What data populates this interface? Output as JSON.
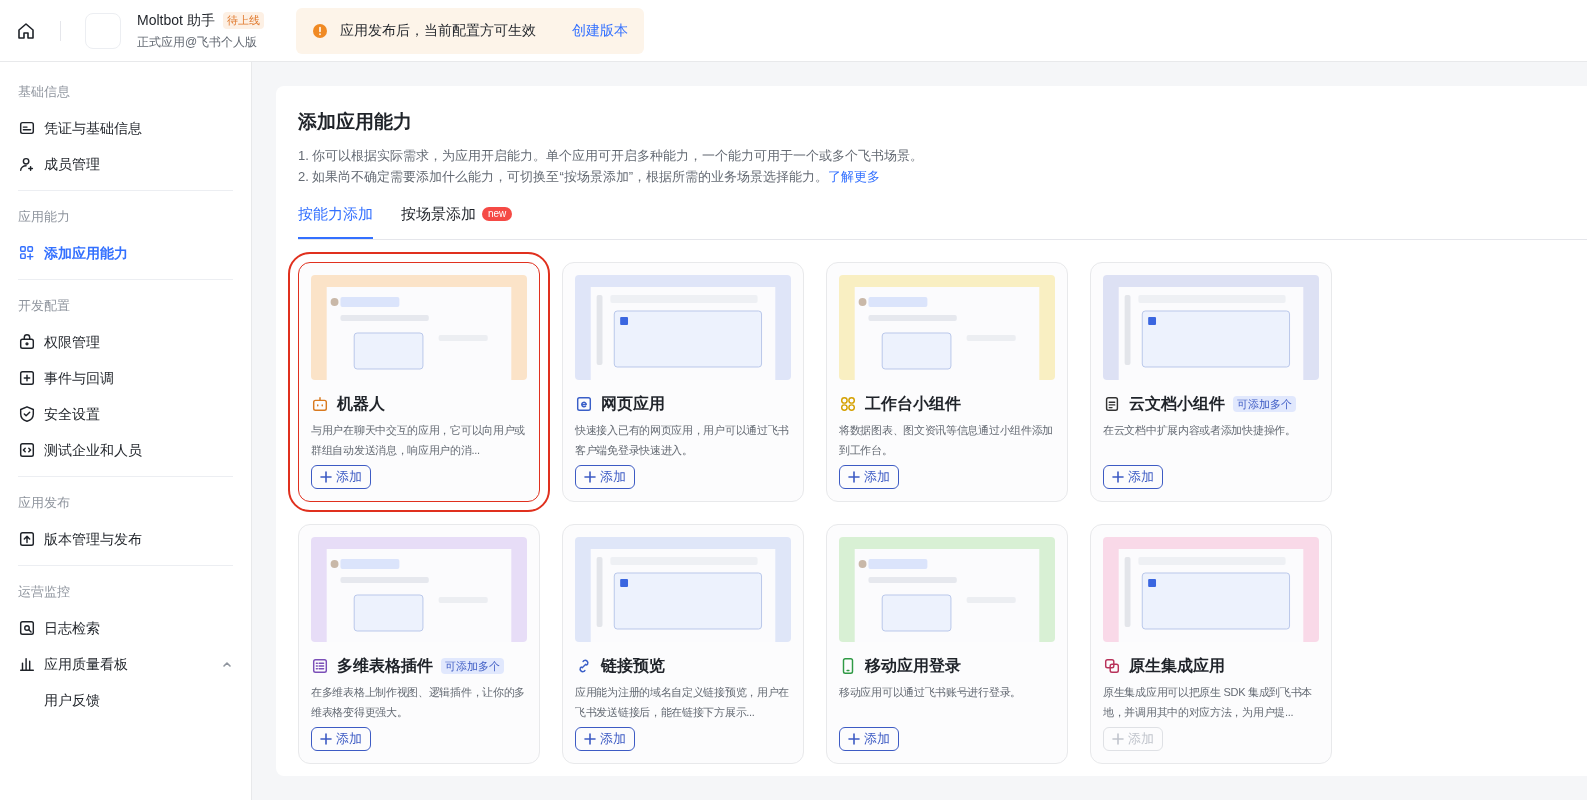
{
  "header": {
    "app_name": "Moltbot 助手",
    "status_badge": "待上线",
    "app_subtitle": "正式应用@飞书个人版",
    "notice": "应用发布后，当前配置方可生效",
    "notice_link": "创建版本"
  },
  "sidebar": {
    "groups": [
      {
        "title": "基础信息",
        "items": [
          {
            "label": "凭证与基础信息",
            "selected": false
          },
          {
            "label": "成员管理",
            "selected": false
          }
        ]
      },
      {
        "title": "应用能力",
        "items": [
          {
            "label": "添加应用能力",
            "selected": true
          }
        ]
      },
      {
        "title": "开发配置",
        "items": [
          {
            "label": "权限管理",
            "selected": false
          },
          {
            "label": "事件与回调",
            "selected": false
          },
          {
            "label": "安全设置",
            "selected": false
          },
          {
            "label": "测试企业和人员",
            "selected": false
          }
        ]
      },
      {
        "title": "应用发布",
        "items": [
          {
            "label": "版本管理与发布",
            "selected": false
          }
        ]
      },
      {
        "title": "运营监控",
        "items": [
          {
            "label": "日志检索",
            "selected": false
          },
          {
            "label": "应用质量看板",
            "selected": false,
            "expanded": true,
            "children": [
              {
                "label": "用户反馈",
                "selected": false
              }
            ]
          }
        ]
      }
    ]
  },
  "main": {
    "title": "添加应用能力",
    "notes": [
      "1. 你可以根据实际需求，为应用开启能力。单个应用可开启多种能力，一个能力可用于一个或多个飞书场景。",
      "2. 如果尚不确定需要添加什么能力，可切换至“按场景添加”，根据所需的业务场景选择能力。"
    ],
    "learn_more": "了解更多",
    "tabs": [
      {
        "label": "按能力添加",
        "selected": true
      },
      {
        "label": "按场景添加",
        "selected": false,
        "badge": "new"
      }
    ],
    "cards": [
      {
        "title": "机器人",
        "description": "与用户在聊天中交互的应用，它可以向用户或群组自动发送消息，响应用户的消...",
        "button": "添加",
        "disabled": false,
        "highlighted": true
      },
      {
        "title": "网页应用",
        "description": "快速接入已有的网页应用，用户可以通过飞书客户端免登录快速进入。",
        "button": "添加",
        "disabled": false,
        "highlighted": false
      },
      {
        "title": "工作台小组件",
        "description": "将数据图表、图文资讯等信息通过小组件添加到工作台。",
        "button": "添加",
        "disabled": false,
        "highlighted": false
      },
      {
        "title": "云文档小组件",
        "tag": "可添加多个",
        "description": "在云文档中扩展内容或者添加快捷操作。",
        "button": "添加",
        "disabled": false,
        "highlighted": false
      },
      {
        "title": "多维表格插件",
        "tag": "可添加多个",
        "description": "在多维表格上制作视图、逻辑插件，让你的多维表格变得更强大。",
        "button": "添加",
        "disabled": false,
        "highlighted": false
      },
      {
        "title": "链接预览",
        "description": "应用能为注册的域名自定义链接预览，用户在飞书发送链接后，能在链接下方展示...",
        "button": "添加",
        "disabled": false,
        "highlighted": false
      },
      {
        "title": "移动应用登录",
        "description": "移动应用可以通过飞书账号进行登录。",
        "button": "添加",
        "disabled": false,
        "highlighted": false
      },
      {
        "title": "原生集成应用",
        "description": "原生集成应用可以把原生 SDK 集成到飞书本地，并调用其中的对应方法，为用户提...",
        "button": "添加",
        "disabled": true,
        "highlighted": false
      }
    ]
  }
}
